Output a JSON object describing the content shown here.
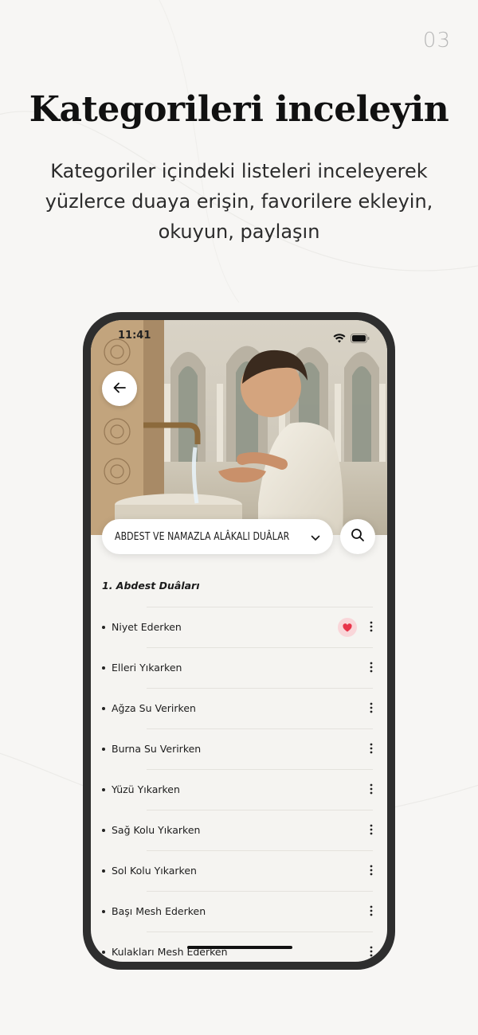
{
  "page": {
    "number": "03",
    "headline": "Kategorileri inceleyin",
    "subtitle_lines": [
      "Kategoriler içindeki listeleri inceleyerek",
      "yüzlerce duaya erişin, favorilere ekleyin,",
      "okuyun, paylaşın"
    ]
  },
  "phone": {
    "status_time": "11:41",
    "hero_image": "boy-performing-ablution-at-fountain",
    "back_icon": "arrow-left-icon",
    "category": {
      "selected": "ABDEST VE NAMAZLA ALÂKALI DUÂLAR",
      "dropdown_icon": "chevron-down-icon"
    },
    "search_icon": "search-icon",
    "section_title": "1. Abdest Duâları",
    "items": [
      {
        "label": "Niyet Ederken",
        "favorite": true
      },
      {
        "label": "Elleri Yıkarken",
        "favorite": false
      },
      {
        "label": "Ağza Su Verirken",
        "favorite": false
      },
      {
        "label": "Burna Su Verirken",
        "favorite": false
      },
      {
        "label": "Yüzü Yıkarken",
        "favorite": false
      },
      {
        "label": "Sağ Kolu Yıkarken",
        "favorite": false
      },
      {
        "label": "Sol Kolu Yıkarken",
        "favorite": false
      },
      {
        "label": "Başı Mesh Ederken",
        "favorite": false
      },
      {
        "label": "Kulakları Mesh Ederken",
        "favorite": false
      }
    ]
  },
  "colors": {
    "favorite": "#e8344a",
    "favorite_bg": "#f9d6d9",
    "phone_frame": "#2e2e2e"
  }
}
